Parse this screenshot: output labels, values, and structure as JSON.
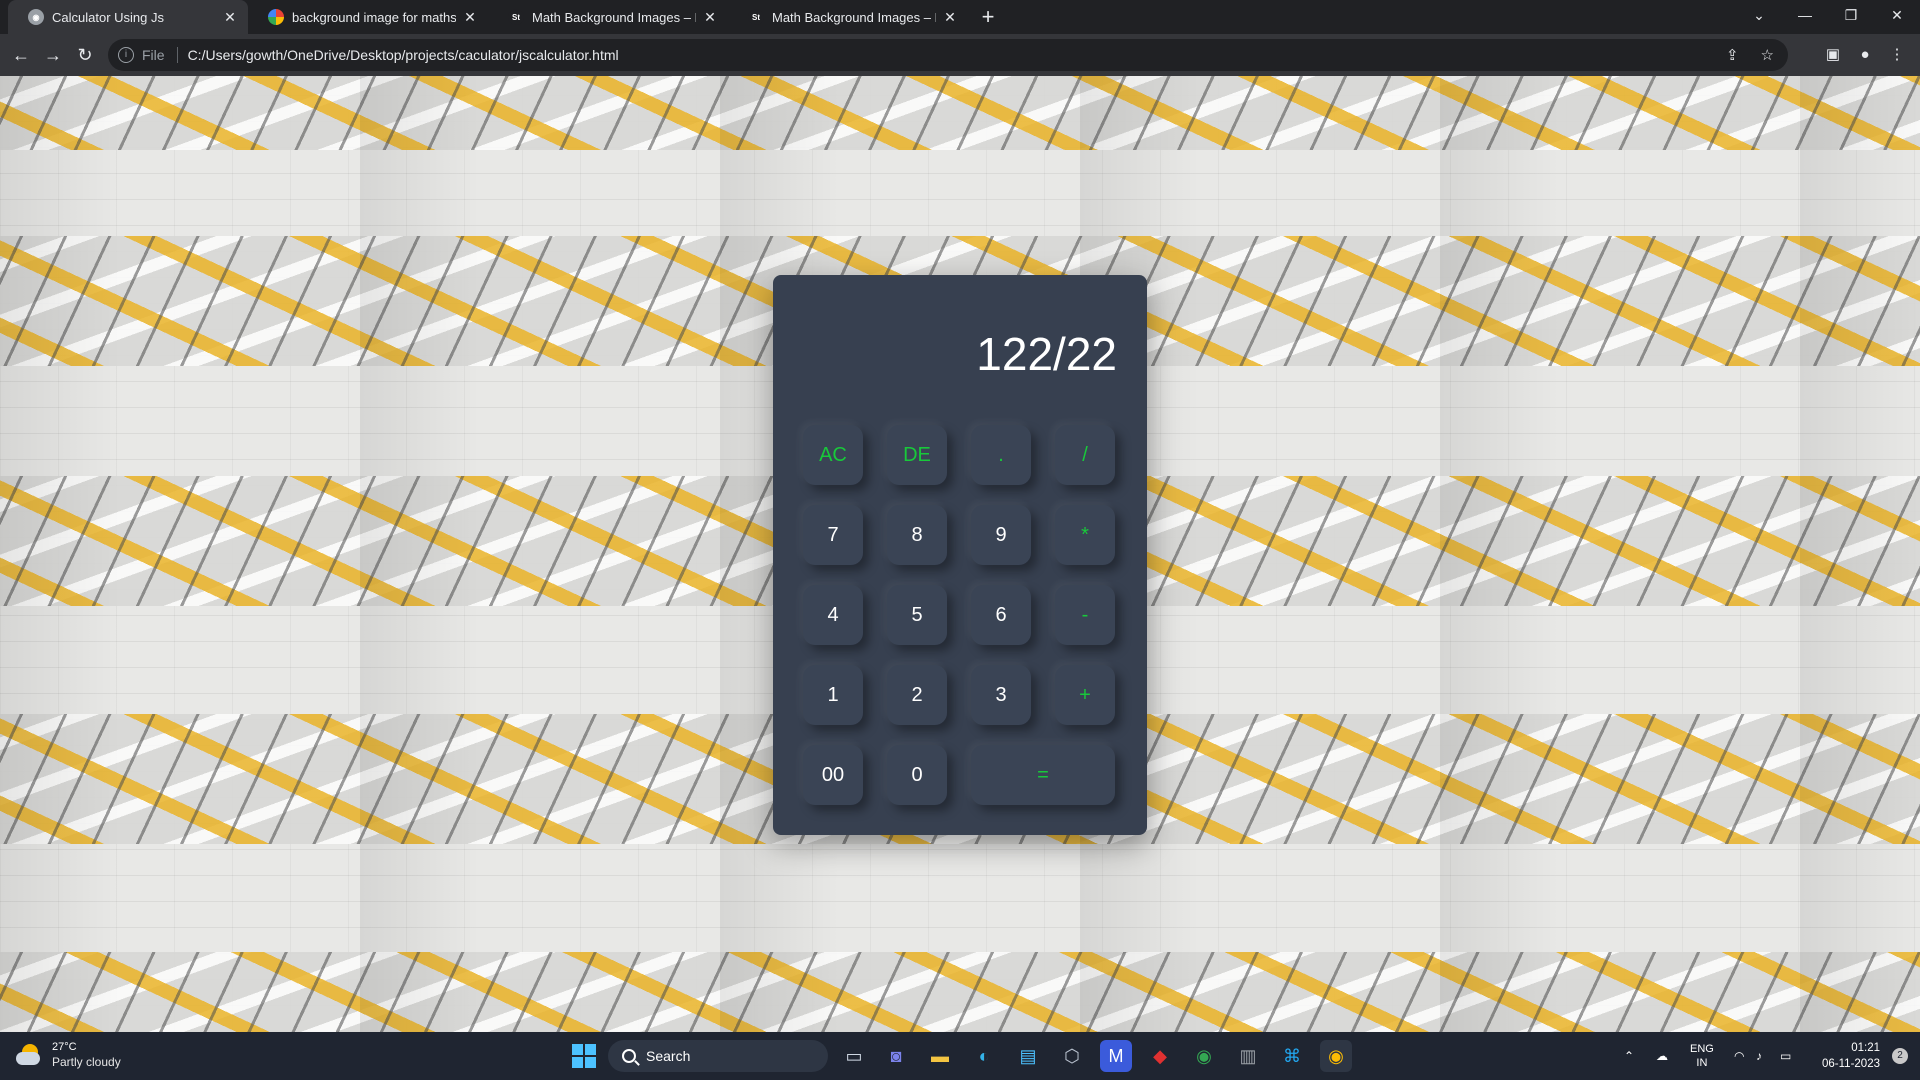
{
  "browser": {
    "tabs": [
      {
        "title": "Calculator Using Js",
        "favicon": "page-icon",
        "active": true
      },
      {
        "title": "background image for maths - G",
        "favicon": "google-icon",
        "active": false
      },
      {
        "title": "Math Background Images – Brow",
        "favicon": "st-icon",
        "active": false
      },
      {
        "title": "Math Background Images – Brow",
        "favicon": "st-icon",
        "active": false
      }
    ],
    "favicon_text": "St",
    "new_tab": "+",
    "address": {
      "scheme": "File",
      "url": "C:/Users/gowth/OneDrive/Desktop/projects/caculator/jscalculator.html"
    }
  },
  "calculator": {
    "display": "122/22",
    "keys": [
      {
        "label": "AC",
        "type": "op"
      },
      {
        "label": "DE",
        "type": "op"
      },
      {
        "label": ".",
        "type": "op"
      },
      {
        "label": "/",
        "type": "op"
      },
      {
        "label": "7",
        "type": "num"
      },
      {
        "label": "8",
        "type": "num"
      },
      {
        "label": "9",
        "type": "num"
      },
      {
        "label": "*",
        "type": "op"
      },
      {
        "label": "4",
        "type": "num"
      },
      {
        "label": "5",
        "type": "num"
      },
      {
        "label": "6",
        "type": "num"
      },
      {
        "label": "-",
        "type": "op"
      },
      {
        "label": "1",
        "type": "num"
      },
      {
        "label": "2",
        "type": "num"
      },
      {
        "label": "3",
        "type": "num"
      },
      {
        "label": "+",
        "type": "op"
      },
      {
        "label": "00",
        "type": "num"
      },
      {
        "label": "0",
        "type": "num"
      },
      {
        "label": "=",
        "type": "op"
      }
    ],
    "colors": {
      "body": "#374050",
      "key": "#3a4455",
      "operator_text": "#18c93a",
      "number_text": "#ffffff"
    }
  },
  "taskbar": {
    "weather": {
      "temp": "27°C",
      "condition": "Partly cloudy"
    },
    "search_label": "Search",
    "tray": {
      "lang_top": "ENG",
      "lang_bottom": "IN"
    },
    "clock": {
      "time": "01:21",
      "date": "06-11-2023"
    },
    "notifications": "2"
  }
}
